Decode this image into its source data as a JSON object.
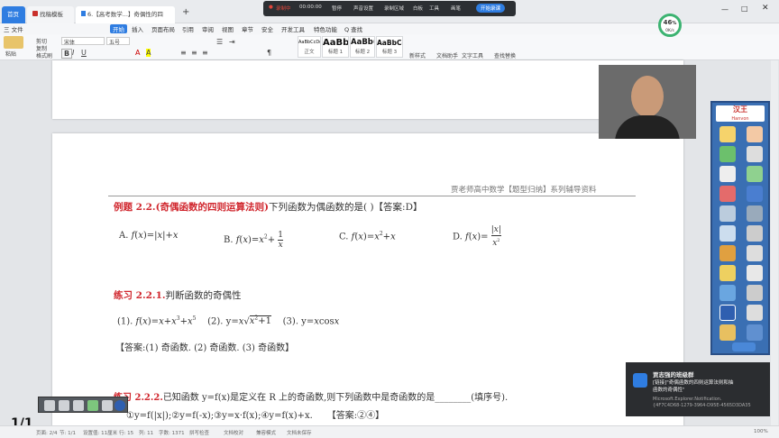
{
  "colors": {
    "accent": "#2f7de1",
    "red": "#d0262d",
    "wps_red": "#c9302c",
    "record": "#e0453a"
  },
  "tabs": [
    {
      "label": "首页",
      "icon": "home-icon"
    },
    {
      "label": "找稿模板",
      "icon": "docer-icon"
    },
    {
      "label": "6.【高考数学...】奇偶性的四",
      "icon": "doc-icon"
    },
    {
      "label": "+",
      "icon": "plus-icon"
    }
  ],
  "menu": [
    "三 文件",
    "开始",
    "插入",
    "页面布局",
    "引用",
    "审阅",
    "视图",
    "章节",
    "安全",
    "开发工具",
    "特色功能",
    "Q 查找"
  ],
  "ribbon": {
    "paste": "粘贴",
    "format_painter": "格式刷",
    "cut": "剪切",
    "copy": "复制",
    "font_name": "宋体",
    "font_size": "五号",
    "bold": "B",
    "italic": "I",
    "underline": "U",
    "styles": [
      {
        "preview": "AaBbCcDd",
        "name": "正文"
      },
      {
        "preview": "AaBb",
        "name": "标题 1"
      },
      {
        "preview": "AaBb(",
        "name": "标题 2"
      },
      {
        "preview": "AaBbCc",
        "name": "标题 3"
      }
    ],
    "new_style": "新样式",
    "text_tools": "文字工具",
    "find_replace": "查找替换",
    "doc_assist": "文档助手"
  },
  "recorder": {
    "status": "录制中",
    "time": "00:00:00",
    "items": [
      "暂停",
      "声音设置",
      "录制区域",
      "白板",
      "工具",
      "画笔"
    ],
    "start": "开始录课"
  },
  "speed": {
    "percent": "46",
    "unit": "%",
    "rate": "0K/s"
  },
  "doc": {
    "header": "贾老师高中数学【题型归纳】系列辅导资料",
    "ex_label": "例题 2.2.(奇偶函数的四则运算法则)",
    "ex_text": "下列函数为偶函数的是(  )【答案:D】",
    "options": {
      "a": "A.",
      "b": "B.",
      "c": "C.",
      "d": "D."
    },
    "pr1_label": "练习 2.2.1.",
    "pr1_text": "判断函数的奇偶性",
    "pr1_items": {
      "i1": "(1).",
      "i2": "(2).",
      "i3": "(3)."
    },
    "pr1_answer": "【答案:(1) 奇函数.   (2) 奇函数.   (3) 奇函数】",
    "pr2_label": "练习 2.2.2.",
    "pr2_text": "已知函数 y=f(x)是定义在 R 上的奇函数,则下列函数中是奇函数的是________(填序号).",
    "pr2_choices": "①y=f(|x|);②y=f(-x);③y=x·f(x);④y=f(x)+x.",
    "pr2_answer": "【答案:②④】"
  },
  "tool_panel": {
    "brand": "汉王",
    "brand_en": "Hanvon"
  },
  "notification": {
    "title": "贾志强的班级群",
    "line1": "[链接]\"奇偶函数的四则运算法则和抽",
    "line2": "函数的奇偶性\"",
    "line3": "Microsoft.Explorer.Notification.",
    "line4": "{4F7C4D68-1279-3964-D95E-4565D3DA35"
  },
  "page_counter": "1/1",
  "status": {
    "page": "页面: 2/4",
    "section": "节: 1/1",
    "settings": "设置值: 11厘米",
    "row": "行: 15",
    "col": "列: 11",
    "words": "字数: 1371",
    "spell": "拼写检查",
    "proofread": "文档校对",
    "layout": "兼容模式",
    "backup": "文档未保存",
    "zoom": "100%"
  }
}
